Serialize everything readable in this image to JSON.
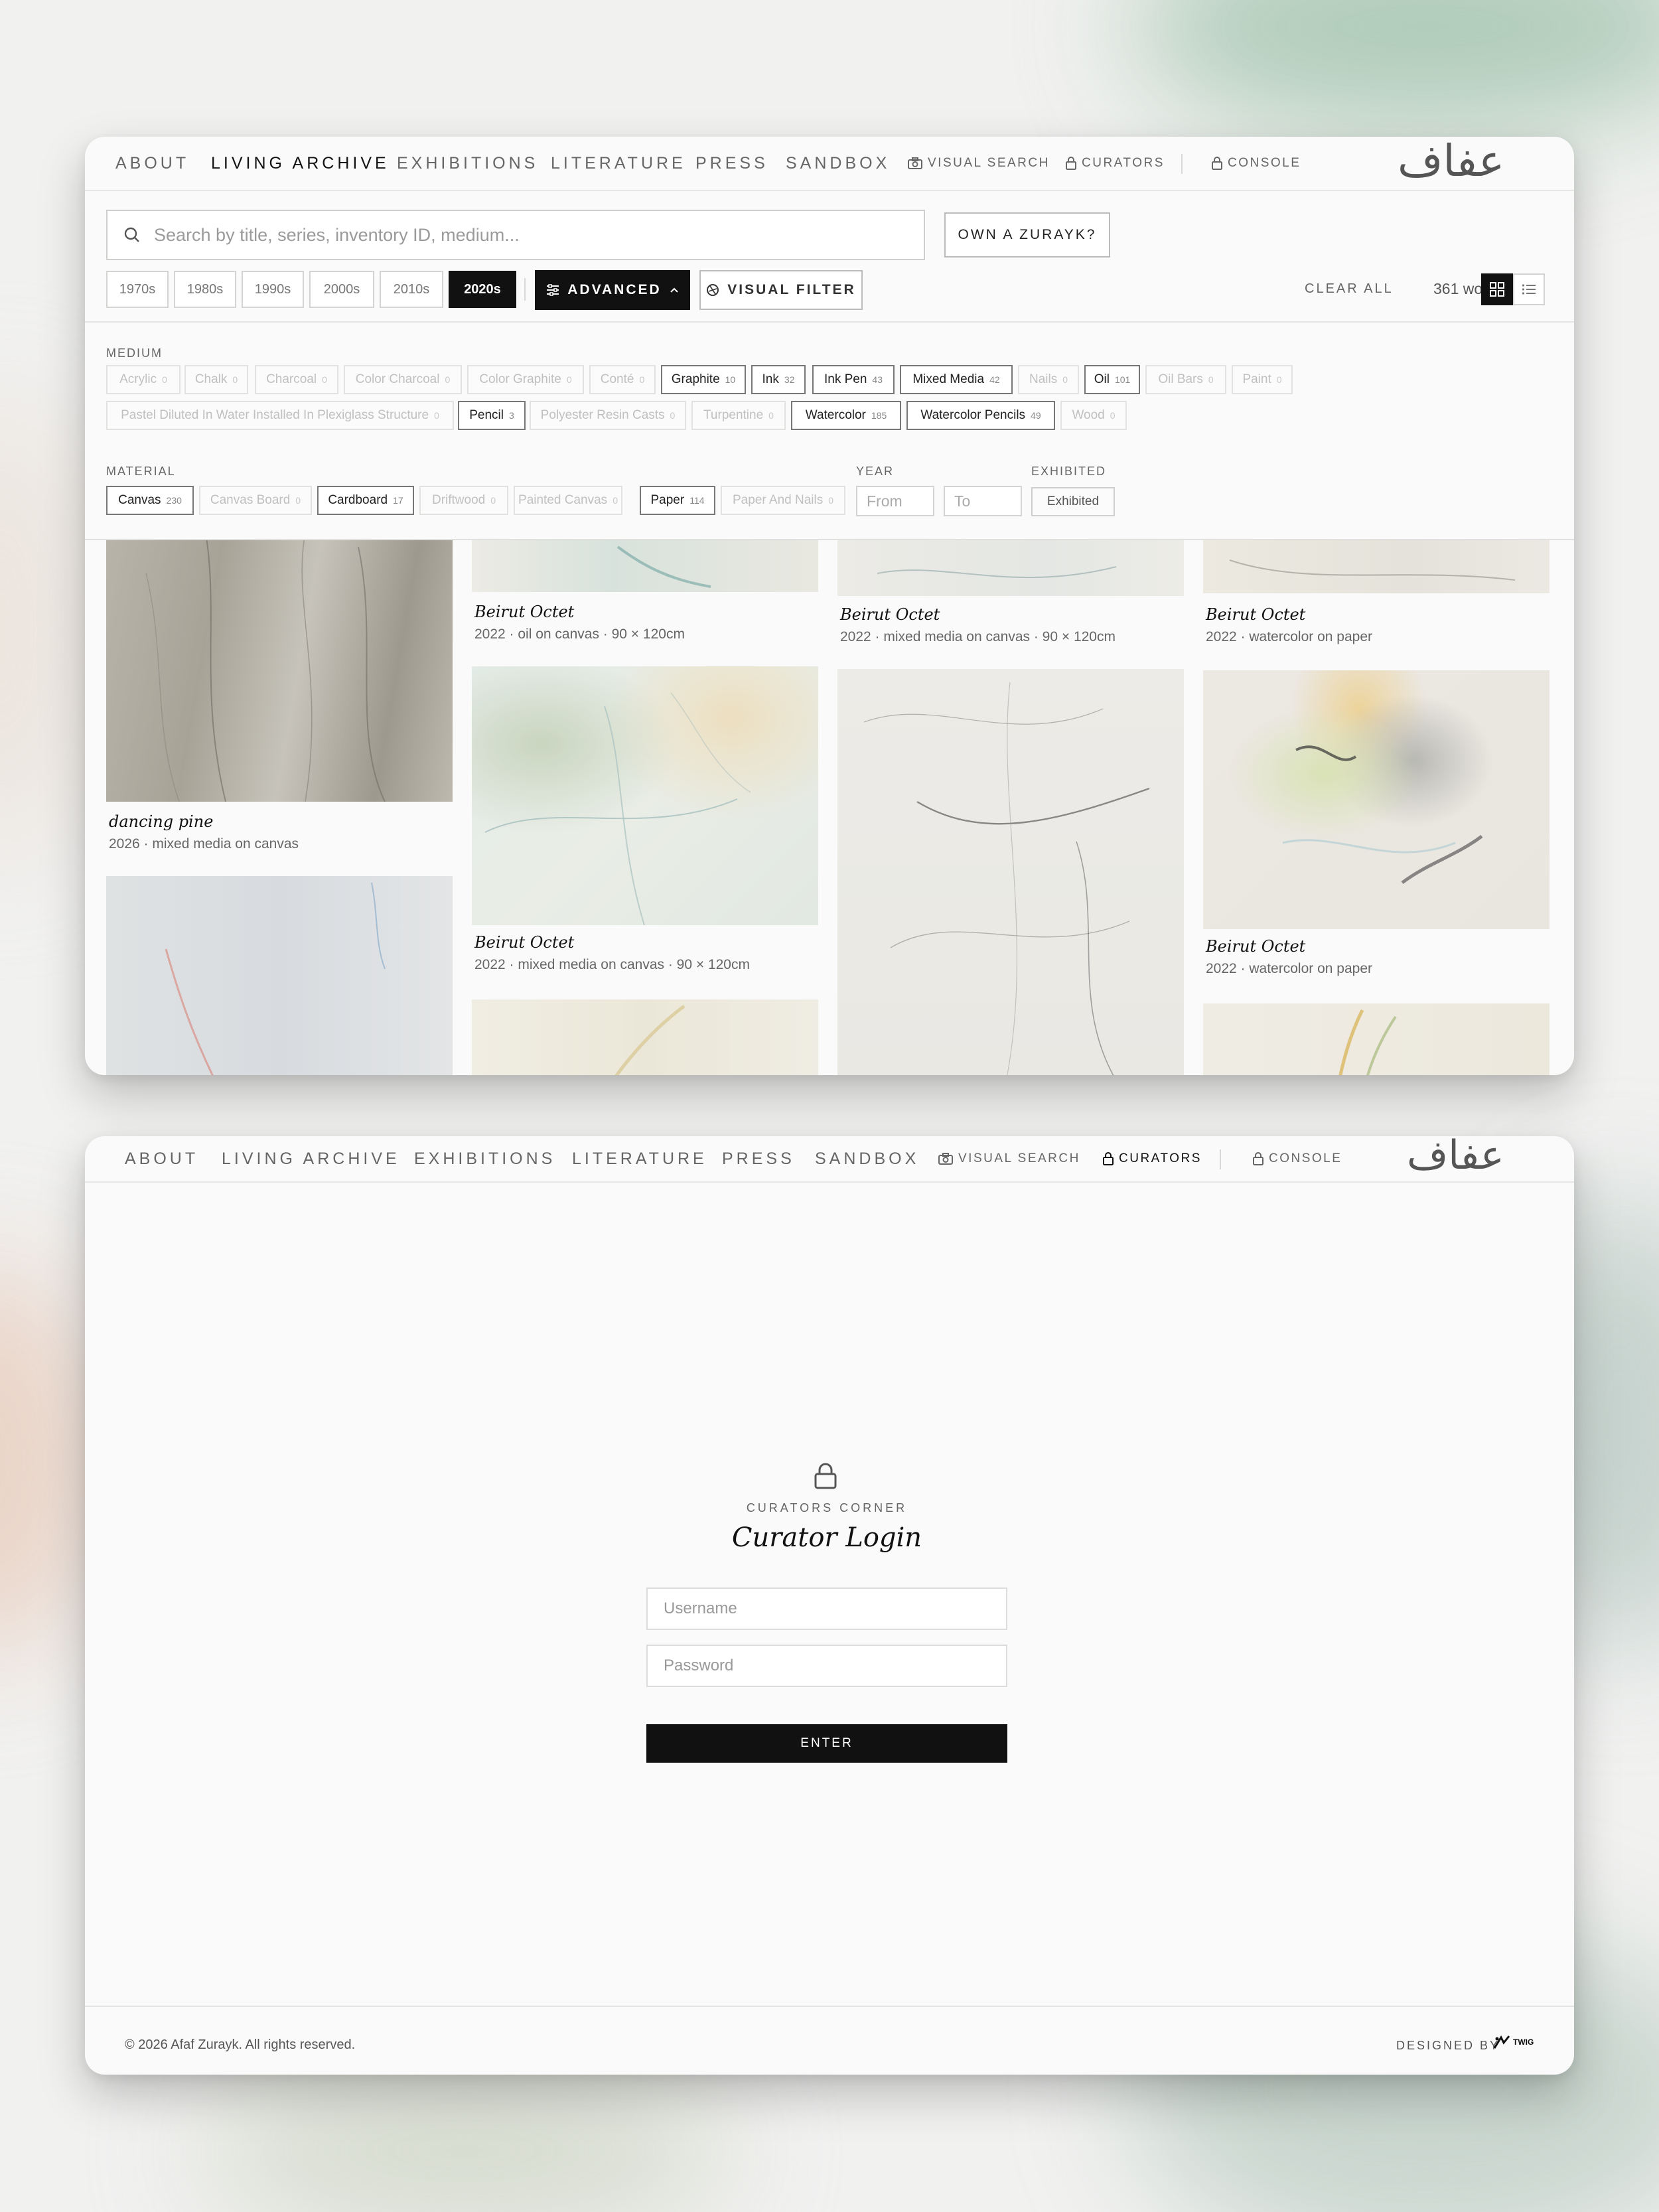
{
  "nav": {
    "items": [
      "About",
      "Living Archive",
      "Exhibitions",
      "Literature",
      "Press",
      "Sandbox"
    ],
    "visual_search": "VISUAL SEARCH",
    "curators": "CURATORS",
    "console": "CONSOLE",
    "logo": "عفاف"
  },
  "toolbar": {
    "search_placeholder": "Search by title, series, inventory ID, medium...",
    "own_label": "OWN A ZURAYK?",
    "decades": [
      "1970s",
      "1980s",
      "1990s",
      "2000s",
      "2010s",
      "2020s"
    ],
    "active_decade": "2020s",
    "advanced_label": "ADVANCED",
    "visual_filter_label": "VISUAL FILTER",
    "clear_all": "CLEAR ALL",
    "works_count": "361 works"
  },
  "filters": {
    "medium_label": "MEDIUM",
    "medium": [
      {
        "label": "Acrylic",
        "count": "0",
        "on": false
      },
      {
        "label": "Chalk",
        "count": "0",
        "on": false
      },
      {
        "label": "Charcoal",
        "count": "0",
        "on": false
      },
      {
        "label": "Color Charcoal",
        "count": "0",
        "on": false
      },
      {
        "label": "Color Graphite",
        "count": "0",
        "on": false
      },
      {
        "label": "Conté",
        "count": "0",
        "on": false
      },
      {
        "label": "Graphite",
        "count": "10",
        "on": true
      },
      {
        "label": "Ink",
        "count": "32",
        "on": true
      },
      {
        "label": "Ink Pen",
        "count": "43",
        "on": true
      },
      {
        "label": "Mixed Media",
        "count": "42",
        "on": true
      },
      {
        "label": "Nails",
        "count": "0",
        "on": false
      },
      {
        "label": "Oil",
        "count": "101",
        "on": true
      },
      {
        "label": "Oil Bars",
        "count": "0",
        "on": false
      },
      {
        "label": "Paint",
        "count": "0",
        "on": false
      },
      {
        "label": "Pastel Diluted In Water Installed In Plexiglass Structure",
        "count": "0",
        "on": false
      },
      {
        "label": "Pencil",
        "count": "3",
        "on": true
      },
      {
        "label": "Polyester Resin Casts",
        "count": "0",
        "on": false
      },
      {
        "label": "Turpentine",
        "count": "0",
        "on": false
      },
      {
        "label": "Watercolor",
        "count": "185",
        "on": true
      },
      {
        "label": "Watercolor Pencils",
        "count": "49",
        "on": true
      },
      {
        "label": "Wood",
        "count": "0",
        "on": false
      }
    ],
    "material_label": "MATERIAL",
    "material": [
      {
        "label": "Canvas",
        "count": "230",
        "on": true
      },
      {
        "label": "Canvas Board",
        "count": "0",
        "on": false
      },
      {
        "label": "Cardboard",
        "count": "17",
        "on": true
      },
      {
        "label": "Driftwood",
        "count": "0",
        "on": false
      },
      {
        "label": "Painted Canvas",
        "count": "0",
        "on": false
      },
      {
        "label": "Paper",
        "count": "114",
        "on": true
      },
      {
        "label": "Paper And Nails",
        "count": "0",
        "on": false
      }
    ],
    "year_label": "YEAR",
    "year_from": "From",
    "year_to": "To",
    "exhibited_label": "EXHIBITED",
    "exhibited_btn": "Exhibited"
  },
  "works": [
    {
      "title": "dancing pine",
      "meta": "2026 · mixed media on canvas"
    },
    {
      "title": "Beirut Octet",
      "meta": "2022 · oil on canvas · 90 × 120cm"
    },
    {
      "title": "Beirut Octet",
      "meta": "2022 · mixed media on canvas · 90 × 120cm"
    },
    {
      "title": "Beirut Octet",
      "meta": "2022 · watercolor on paper"
    },
    {
      "title": "Beirut Octet",
      "meta": "2022 · mixed media on canvas · 90 × 120cm"
    },
    {
      "title": "Beirut Octet",
      "meta": "2022 · watercolor on paper"
    }
  ],
  "login": {
    "eyebrow": "CURATORS CORNER",
    "title": "Curator Login",
    "username_placeholder": "Username",
    "password_placeholder": "Password",
    "enter_label": "ENTER"
  },
  "footer": {
    "copyright": "© 2026 Afaf Zurayk. All rights reserved.",
    "designed_by": "DESIGNED BY",
    "brand": "TWIG"
  }
}
